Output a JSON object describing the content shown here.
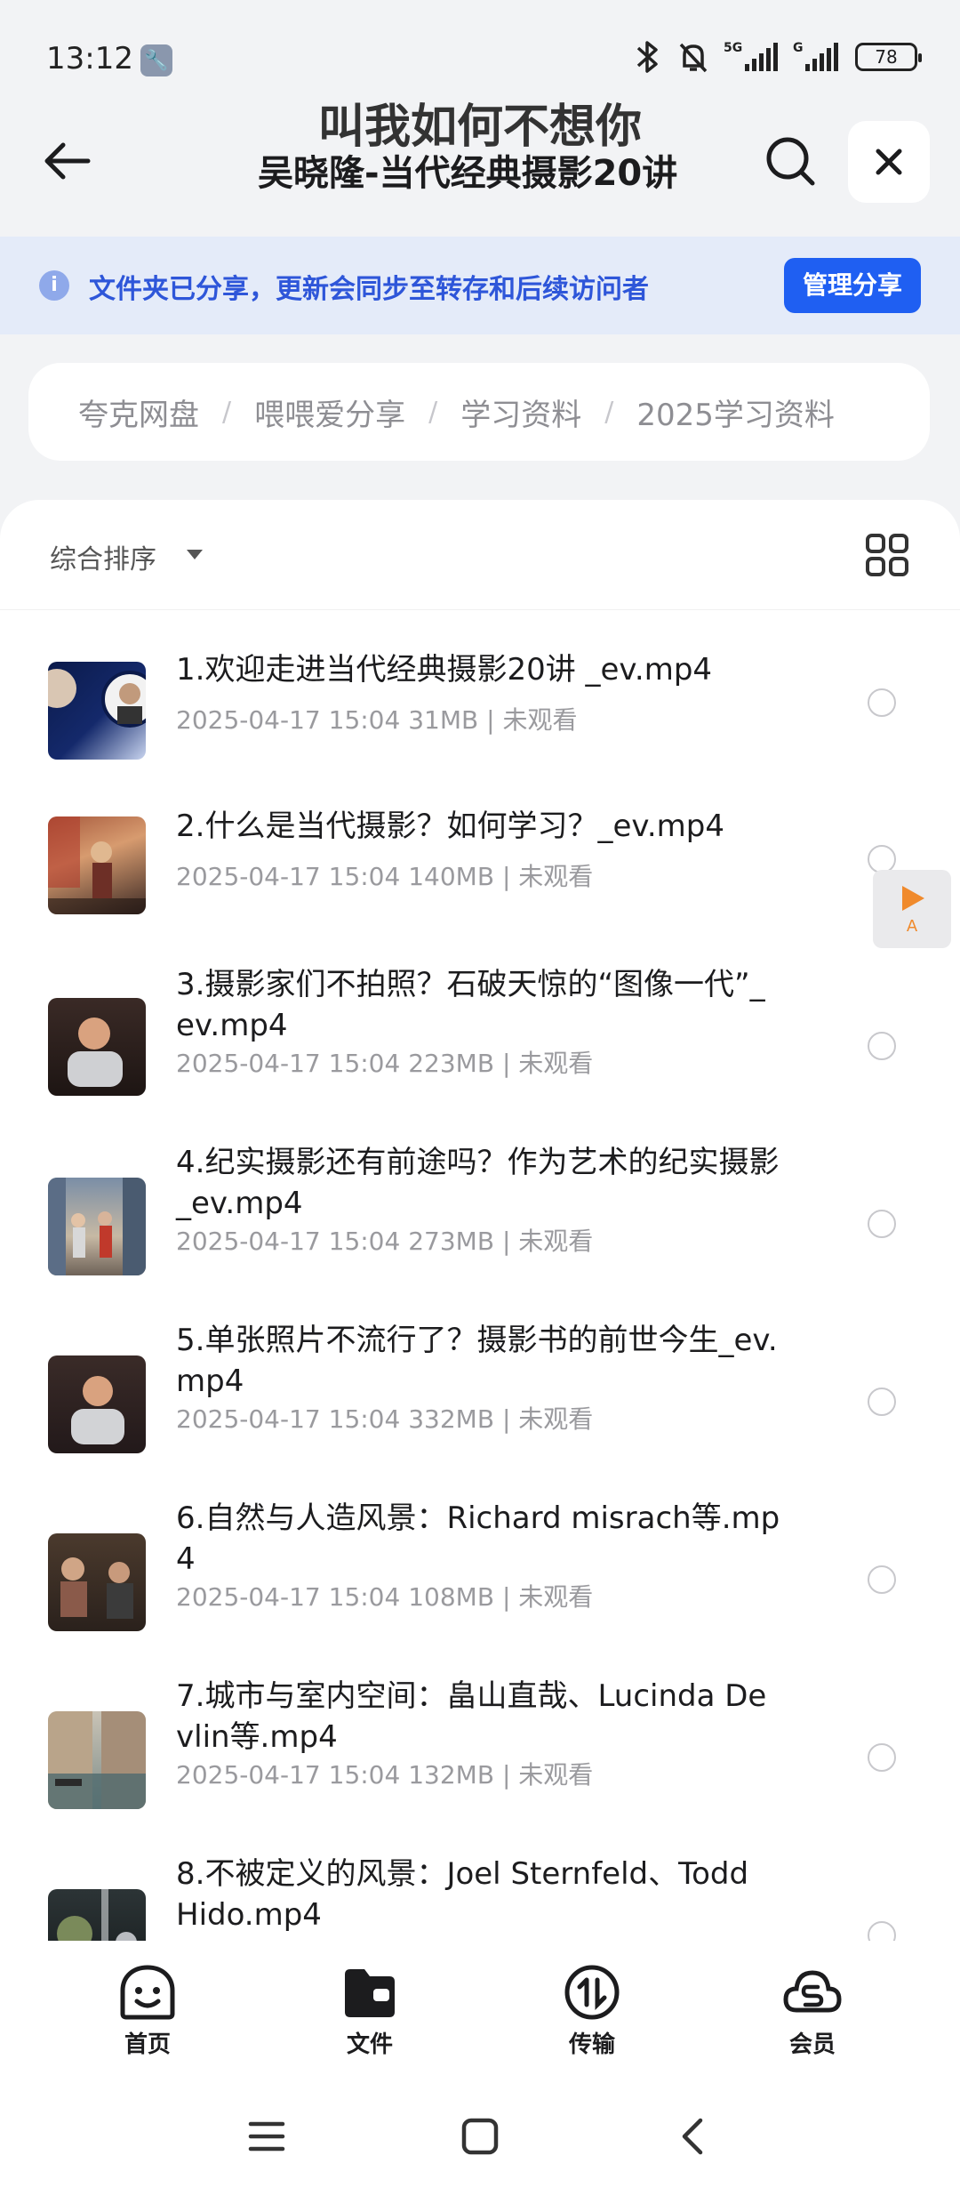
{
  "status": {
    "time": "13:12",
    "battery": "78"
  },
  "header": {
    "title_line1": "叫我如何不想你",
    "title_line2": "吴晓隆-当代经典摄影20讲"
  },
  "share_banner": {
    "text": "文件夹已分享，更新会同步至转存和后续访问者",
    "button": "管理分享"
  },
  "breadcrumb": [
    "夸克网盘",
    "喂喂爱分享",
    "学习资料",
    "2025学习资料"
  ],
  "sort": {
    "label": "综合排序"
  },
  "files": [
    {
      "name": "1.欢迎走进当代经典摄影20讲 _ev.mp4",
      "date": "2025-04-17 15:04",
      "size": "31MB",
      "status": "未观看"
    },
    {
      "name": "2.什么是当代摄影？如何学习？_ev.mp4",
      "date": "2025-04-17 15:04",
      "size": "140MB",
      "status": "未观看"
    },
    {
      "name": "3.摄影家们不拍照？石破天惊的“图像一代”_ev.mp4",
      "date": "2025-04-17 15:04",
      "size": "223MB",
      "status": "未观看"
    },
    {
      "name": "4.纪实摄影还有前途吗？作为艺术的纪实摄影_ev.mp4",
      "date": "2025-04-17 15:04",
      "size": "273MB",
      "status": "未观看"
    },
    {
      "name": "5.单张照片不流行了？摄影书的前世今生_ev.mp4",
      "date": "2025-04-17 15:04",
      "size": "332MB",
      "status": "未观看"
    },
    {
      "name": "6.自然与人造风景：Richard misrach等.mp4",
      "date": "2025-04-17 15:04",
      "size": "108MB",
      "status": "未观看"
    },
    {
      "name": "7.城市与室内空间：畠山直哉、Lucinda Devlin等.mp4",
      "date": "2025-04-17 15:04",
      "size": "132MB",
      "status": "未观看"
    },
    {
      "name": "8.不被定义的风景：Joel Sternfeld、Todd Hido.mp4",
      "date": "",
      "size": "",
      "status": ""
    }
  ],
  "float_button": {
    "letter": "A"
  },
  "tabs": [
    {
      "label": "首页",
      "icon": "smiley-home-icon"
    },
    {
      "label": "文件",
      "icon": "folder-icon"
    },
    {
      "label": "传输",
      "icon": "transfer-icon"
    },
    {
      "label": "会员",
      "icon": "member-cloud-icon"
    }
  ],
  "colors": {
    "accent": "#1f5ff2",
    "banner_bg": "#e4ebf9",
    "banner_text": "#2e56d9",
    "float_play": "#f08a2c"
  }
}
